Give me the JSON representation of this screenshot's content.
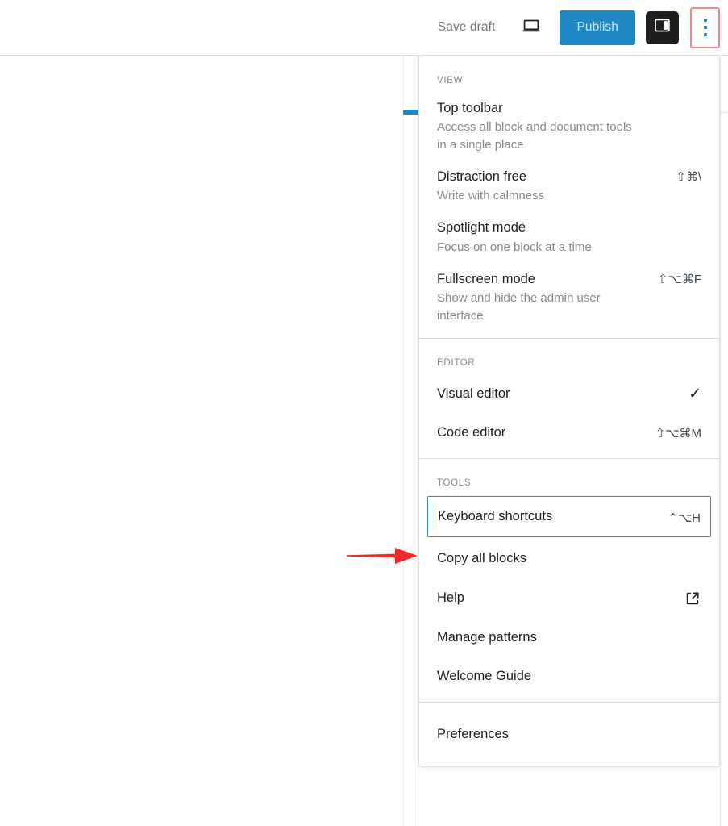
{
  "header": {
    "save_draft_label": "Save draft",
    "preview_icon": "laptop-preview-icon",
    "publish_label": "Publish",
    "sidebar_toggle_icon": "sidebar-panel-icon",
    "options_icon": "three-vertical-dots-icon",
    "accent_color": "#1e87c4",
    "highlight_border_color": "#ef8a8a",
    "toggle_bg_color": "#1e1e1e"
  },
  "annotation": {
    "arrow_color": "#ee2a2a",
    "arrow_name": "red-pointer-arrow"
  },
  "menu": {
    "groups": [
      {
        "label": "VIEW",
        "items": [
          {
            "title": "Top toolbar",
            "desc": "Access all block and document tools in a single place",
            "shortcut": "",
            "checked": false
          },
          {
            "title": "Distraction free",
            "desc": "Write with calmness",
            "shortcut": "⇧⌘\\",
            "checked": false
          },
          {
            "title": "Spotlight mode",
            "desc": "Focus on one block at a time",
            "shortcut": "",
            "checked": false
          },
          {
            "title": "Fullscreen mode",
            "desc": "Show and hide the admin user interface",
            "shortcut": "⇧⌥⌘F",
            "checked": false
          }
        ]
      },
      {
        "label": "EDITOR",
        "items": [
          {
            "title": "Visual editor",
            "desc": "",
            "shortcut": "",
            "checked": true,
            "check_glyph": "✓"
          },
          {
            "title": "Code editor",
            "desc": "",
            "shortcut": "⇧⌥⌘M",
            "checked": false
          }
        ]
      },
      {
        "label": "TOOLS",
        "items": [
          {
            "title": "Keyboard shortcuts",
            "desc": "",
            "shortcut": "⌃⌥H",
            "checked": false,
            "focused": true
          },
          {
            "title": "Copy all blocks",
            "desc": "",
            "shortcut": "",
            "checked": false
          },
          {
            "title": "Help",
            "desc": "",
            "shortcut": "",
            "checked": false,
            "icon": "external-link-icon"
          },
          {
            "title": "Manage patterns",
            "desc": "",
            "shortcut": "",
            "checked": false
          },
          {
            "title": "Welcome Guide",
            "desc": "",
            "shortcut": "",
            "checked": false
          }
        ]
      },
      {
        "label": "",
        "items": [
          {
            "title": "Preferences",
            "desc": "",
            "shortcut": "",
            "checked": false
          }
        ]
      }
    ]
  }
}
